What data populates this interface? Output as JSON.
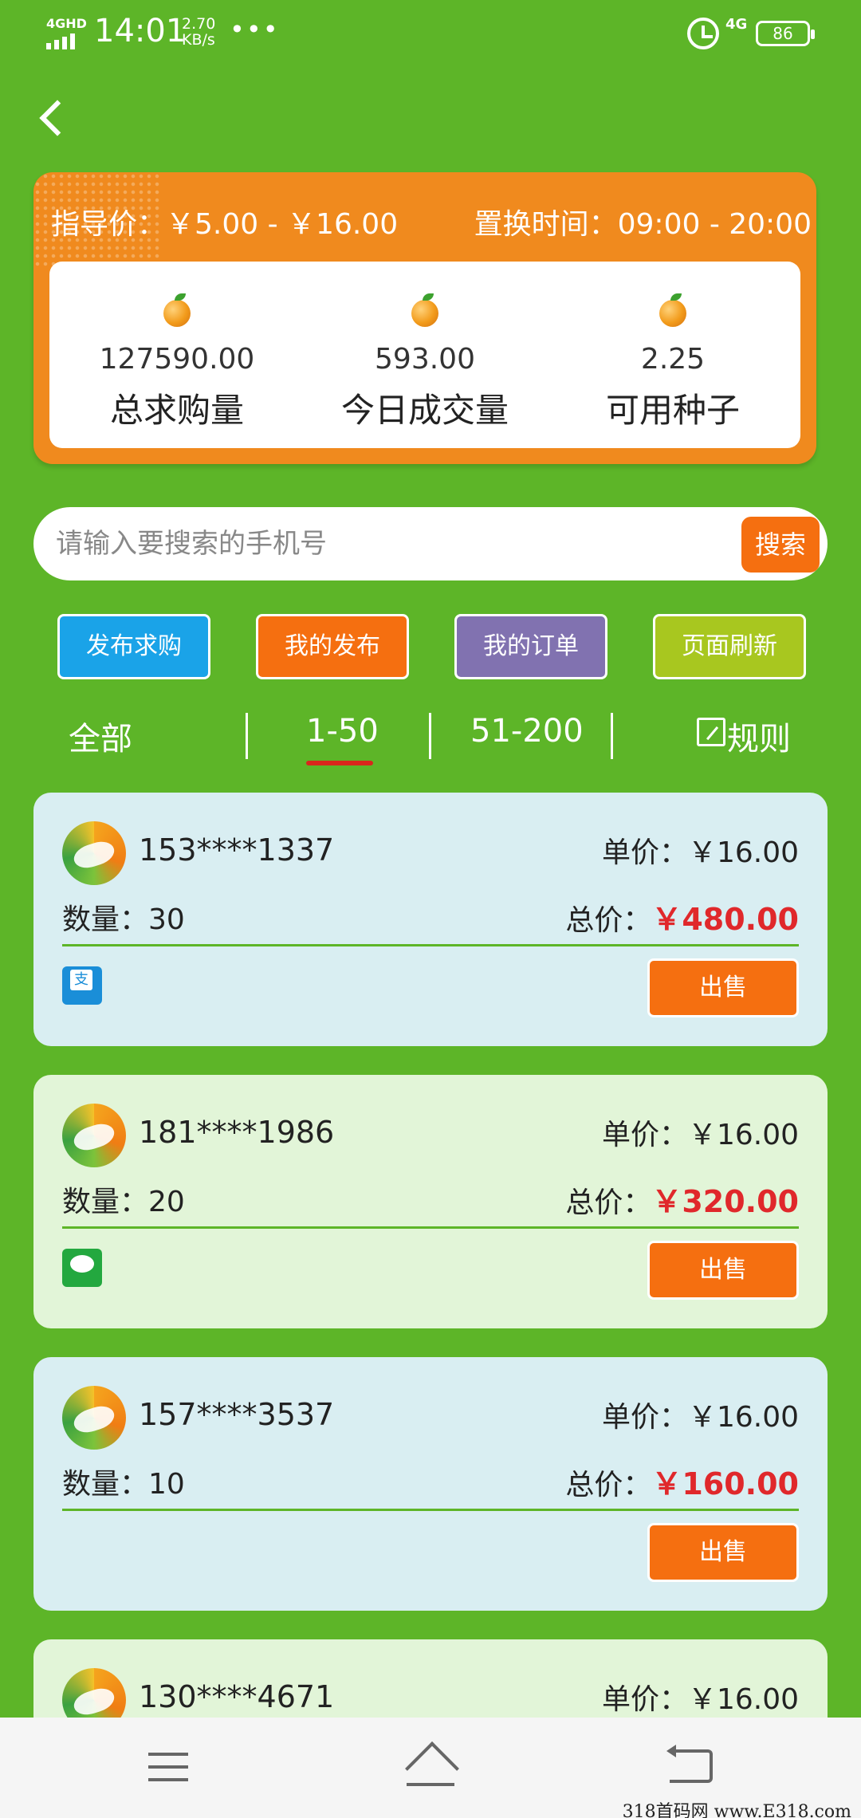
{
  "status_bar": {
    "network": "4GHD",
    "time": "14:01",
    "speed": "2.70",
    "speed_unit": "KB/s",
    "more": "•••",
    "network_right": "4G",
    "battery": "86"
  },
  "guide": {
    "price_range": "指导价：￥5.00 - ￥16.00",
    "exchange_time": "置换时间：09:00 - 20:00",
    "stats": [
      {
        "value": "127590.00",
        "label": "总求购量",
        "icon": "orange-fruit-icon"
      },
      {
        "value": "593.00",
        "label": "今日成交量",
        "icon": "orange-fruit-icon"
      },
      {
        "value": "2.25",
        "label": "可用种子",
        "icon": "orange-fruit-icon"
      }
    ]
  },
  "search": {
    "placeholder": "请输入要搜索的手机号",
    "button": "搜索"
  },
  "actions": [
    {
      "label": "发布求购",
      "color": "#1aa3e8"
    },
    {
      "label": "我的发布",
      "color": "#f56f10"
    },
    {
      "label": "我的订单",
      "color": "#8172b0"
    },
    {
      "label": "页面刷新",
      "color": "#a8c71f"
    }
  ],
  "filters": {
    "all": "全部",
    "range1": "1-50",
    "range2": "51-200",
    "rules": "规则",
    "active": "1-50"
  },
  "orders": [
    {
      "phone": "153****1337",
      "unit_price": "单价：￥16.00",
      "quantity": "数量：30",
      "total_label": "总价：",
      "total": "￥480.00",
      "payment": "alipay",
      "sell": "出售"
    },
    {
      "phone": "181****1986",
      "unit_price": "单价：￥16.00",
      "quantity": "数量：20",
      "total_label": "总价：",
      "total": "￥320.00",
      "payment": "wechat",
      "sell": "出售"
    },
    {
      "phone": "157****3537",
      "unit_price": "单价：￥16.00",
      "quantity": "数量：10",
      "total_label": "总价：",
      "total": "￥160.00",
      "payment": "",
      "sell": "出售"
    },
    {
      "phone": "130****4671",
      "unit_price": "单价：￥16.00"
    }
  ],
  "watermark": "318首码网 www.E318.com",
  "colors": {
    "background": "#5db528",
    "orange": "#f08a1e",
    "button_orange": "#f56f10",
    "price_red": "#e0282b"
  }
}
